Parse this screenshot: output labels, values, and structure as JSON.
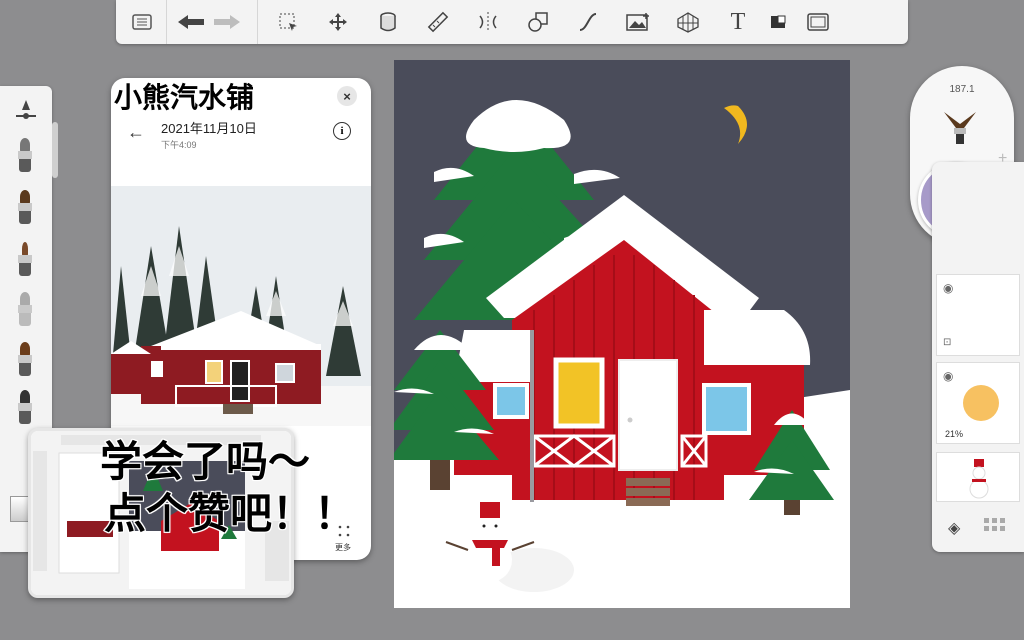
{
  "toolbar": {
    "items": [
      "list-icon",
      "undo-icon",
      "redo-icon",
      "select-icon",
      "transform-icon",
      "fill-icon",
      "ruler-icon",
      "symmetry-icon",
      "shape-icon",
      "curve-icon",
      "image-icon",
      "perspective-icon",
      "text-icon",
      "swatch-icon",
      "fullscreen-icon"
    ],
    "text_label": "T"
  },
  "reference": {
    "title_overlay": "小熊汽水铺",
    "date": "2021年11月10日",
    "time": "下午4:09",
    "more_label": "更多"
  },
  "overlay": {
    "line1": "学会了吗～",
    "line2": "点个赞吧！！"
  },
  "brush_puck": {
    "size": "187.1",
    "color": "#a79ac9"
  },
  "layers": {
    "opacity_label": "21%"
  },
  "colors": {
    "sky": "#4a4c5a",
    "house_red": "#c3121f",
    "tree_green": "#1f7a3c",
    "snow": "#ffffff",
    "window_yellow": "#f2c326",
    "window_blue": "#7cc6e8",
    "moon": "#f0b81f"
  }
}
